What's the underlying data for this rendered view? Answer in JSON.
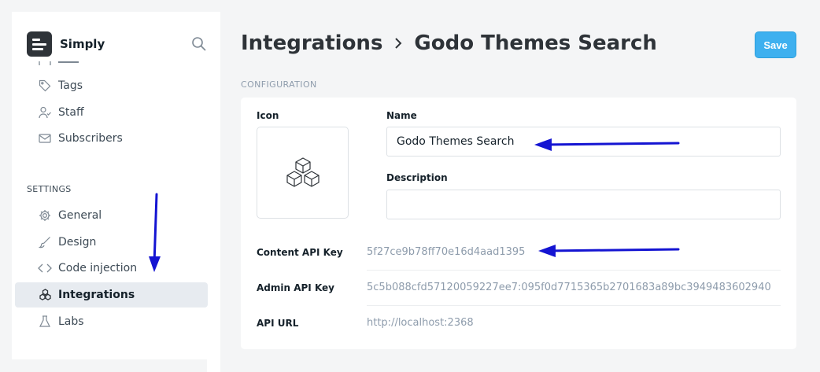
{
  "sidebar": {
    "brand": "Simply",
    "items_top": [
      {
        "label": "Tags",
        "icon": "tag-icon"
      },
      {
        "label": "Staff",
        "icon": "staff-icon"
      },
      {
        "label": "Subscribers",
        "icon": "mail-icon"
      }
    ],
    "section_label": "SETTINGS",
    "items_settings": [
      {
        "label": "General",
        "icon": "gear-icon"
      },
      {
        "label": "Design",
        "icon": "brush-icon"
      },
      {
        "label": "Code injection",
        "icon": "code-icon"
      },
      {
        "label": "Integrations",
        "icon": "integrations-icon",
        "active": true
      },
      {
        "label": "Labs",
        "icon": "flask-icon"
      }
    ]
  },
  "header": {
    "crumb_parent": "Integrations",
    "crumb_current": "Godo Themes Search",
    "save_label": "Save"
  },
  "config": {
    "section_label": "CONFIGURATION",
    "icon_label": "Icon",
    "name_label": "Name",
    "name_value": "Godo Themes Search",
    "description_label": "Description",
    "description_value": "",
    "content_api_key_label": "Content API Key",
    "content_api_key_value": "5f27ce9b78ff70e16d4aad1395",
    "admin_api_key_label": "Admin API Key",
    "admin_api_key_value": "5c5b088cfd57120059227ee7:095f0d7715365b2701683a89bc3949483602940",
    "api_url_label": "API URL",
    "api_url_value": "http://localhost:2368"
  },
  "colors": {
    "accent": "#3eb0ef",
    "annotation_arrow": "#1414d2",
    "active_nav_bg": "#e7ebf0"
  }
}
